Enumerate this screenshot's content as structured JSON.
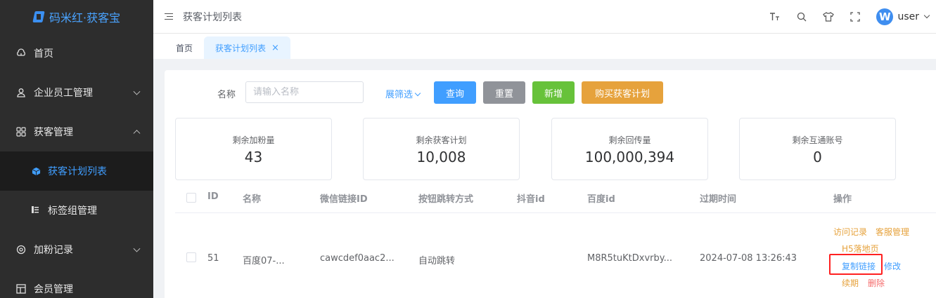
{
  "app": {
    "name": "码米红·获客宝"
  },
  "sidebar": {
    "items": [
      {
        "label": "首页",
        "icon": "cloud-home-icon"
      },
      {
        "label": "企业员工管理",
        "icon": "user-icon"
      },
      {
        "label": "获客管理",
        "icon": "grid-icon"
      },
      {
        "label": "获客计划列表",
        "icon": "cube-icon"
      },
      {
        "label": "标签组管理",
        "icon": "list-icon"
      },
      {
        "label": "加粉记录",
        "icon": "settings-icon"
      },
      {
        "label": "会员管理",
        "icon": "panel-icon"
      }
    ]
  },
  "header": {
    "title": "获客计划列表",
    "user": {
      "avatar_letter": "W",
      "name": "user"
    }
  },
  "tabs": [
    {
      "label": "首页"
    },
    {
      "label": "获客计划列表",
      "close": "×"
    }
  ],
  "search": {
    "name_label": "名称",
    "name_placeholder": "请输入名称",
    "expand_label": "展筛选",
    "query_label": "查询",
    "reset_label": "重置",
    "add_label": "新增",
    "buy_label": "购买获客计划"
  },
  "stats": [
    {
      "title": "剩余加粉量",
      "value": "43"
    },
    {
      "title": "剩余获客计划",
      "value": "10,008"
    },
    {
      "title": "剩余回传量",
      "value": "100,000,394"
    },
    {
      "title": "剩余互通账号",
      "value": "0"
    }
  ],
  "table": {
    "columns": [
      "ID",
      "名称",
      "微信链接ID",
      "按钮跳转方式",
      "抖音id",
      "百度id",
      "过期时间",
      "操作"
    ],
    "rows": [
      {
        "id": "51",
        "name": "百度07-...",
        "wx_link_id": "cawcdef0aac2...",
        "jump_mode": "自动跳转",
        "douyin_id": "",
        "baidu_id": "M8R5tuKtDxvrby...",
        "expire": "2024-07-08 13:26:43",
        "actions": {
          "visit": "访问记录",
          "service": "客服管理",
          "h5": "H5落地页",
          "copy": "复制链接",
          "edit": "修改",
          "renew": "续期",
          "delete": "删除"
        }
      }
    ]
  }
}
